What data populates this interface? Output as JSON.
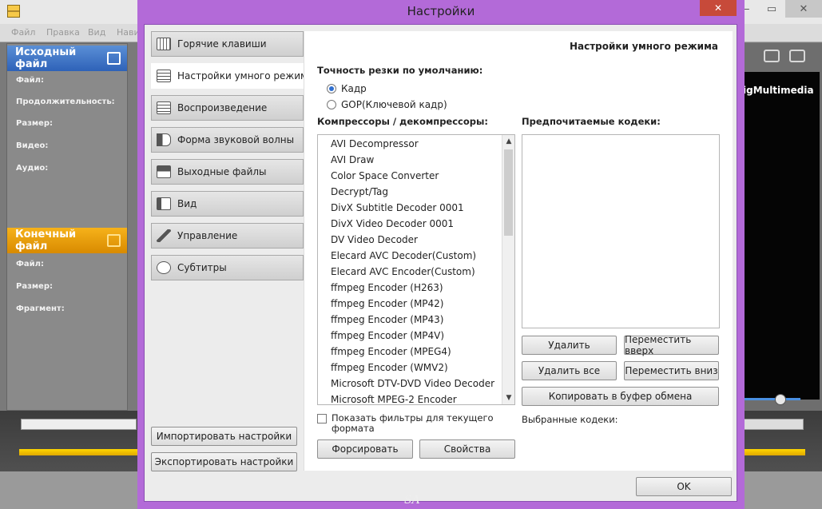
{
  "background_app": {
    "menu": [
      "Файл",
      "Правка",
      "Вид",
      "Нави"
    ],
    "source_section": {
      "title": "Исходный файл",
      "fields": [
        "Файл:",
        "Продолжительность:",
        "Размер:",
        "Видео:",
        "Аудио:"
      ]
    },
    "output_section": {
      "title": "Конечный файл",
      "fields": [
        "Файл:",
        "Размер:",
        "Фрагмент:"
      ]
    },
    "video_overlay_text": "igMultimedia",
    "window_buttons": {
      "minimize": "—",
      "maximize": "▭",
      "close": "✕"
    },
    "watermark": "SA"
  },
  "dialog": {
    "title": "Настройки",
    "close_glyph": "✕",
    "nav": [
      {
        "label": "Горячие клавиши",
        "icon": "keyboard-icon",
        "active": false
      },
      {
        "label": "Настройки умного режима",
        "icon": "film-icon",
        "active": true
      },
      {
        "label": "Воспроизведение",
        "icon": "film-icon",
        "active": false
      },
      {
        "label": "Форма звуковой волны",
        "icon": "speaker-icon",
        "active": false
      },
      {
        "label": "Выходные файлы",
        "icon": "save-icon",
        "active": false
      },
      {
        "label": "Вид",
        "icon": "view-icon",
        "active": false
      },
      {
        "label": "Управление",
        "icon": "wrench-icon",
        "active": false
      },
      {
        "label": "Субтитры",
        "icon": "speech-bubble-icon",
        "active": false
      }
    ],
    "import_button": "Импортировать настройки",
    "export_button": "Экспортировать настройки",
    "ok_button": "OK",
    "panel": {
      "header": "Настройки умного режима",
      "precision_label": "Точность резки по умолчанию:",
      "radio_options": [
        {
          "label": "Кадр",
          "checked": true
        },
        {
          "label": "GOP(Ключевой кадр)",
          "checked": false
        }
      ],
      "compressors_label": "Компрессоры / декомпрессоры:",
      "compressors": [
        "AVI Decompressor",
        "AVI Draw",
        "Color Space Converter",
        "Decrypt/Tag",
        "DivX Subtitle Decoder 0001",
        "DivX Video Decoder 0001",
        "DV Video Decoder",
        "Elecard AVC Decoder(Custom)",
        "Elecard AVC Encoder(Custom)",
        "ffmpeg Encoder (H263)",
        "ffmpeg Encoder (MP42)",
        "ffmpeg Encoder (MP43)",
        "ffmpeg Encoder (MP4V)",
        "ffmpeg Encoder (MPEG4)",
        "ffmpeg Encoder (WMV2)",
        "Microsoft DTV-DVD Video Decoder",
        "Microsoft MPEG-2 Encoder"
      ],
      "preferred_label": "Предпочитаемые кодеки:",
      "delete_button": "Удалить",
      "move_up_button": "Переместить вверх",
      "delete_all_button": "Удалить все",
      "move_down_button": "Переместить вниз",
      "copy_button": "Копировать в буфер обмена",
      "show_filters_label": "Показать фильтры для текущего формата",
      "selected_codecs_label": "Выбранные кодеки:",
      "force_button": "Форсировать",
      "properties_button": "Свойства"
    }
  },
  "colors": {
    "dialog_frame": "#b36ad8",
    "source_header": "#2e62b8",
    "output_header": "#d88a00",
    "radio_accent": "#2f6fd0"
  }
}
